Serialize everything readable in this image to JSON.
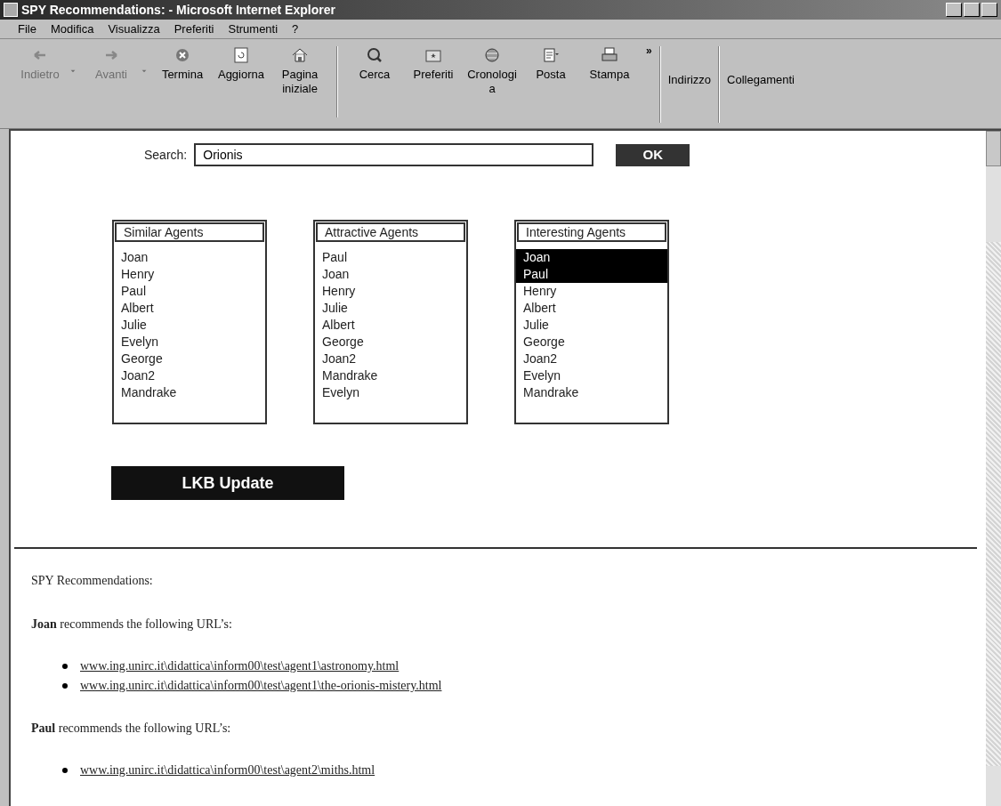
{
  "window": {
    "title": "SPY Recommendations: - Microsoft Internet Explorer"
  },
  "menu": [
    "File",
    "Modifica",
    "Visualizza",
    "Preferiti",
    "Strumenti",
    "?"
  ],
  "toolbar": [
    {
      "kind": "button",
      "label": "Indietro",
      "disabled": true
    },
    {
      "kind": "dropdown",
      "disabled": true
    },
    {
      "kind": "button",
      "label": "Avanti",
      "disabled": true
    },
    {
      "kind": "dropdown",
      "disabled": true
    },
    {
      "kind": "button",
      "label": "Termina",
      "disabled": false
    },
    {
      "kind": "button",
      "label": "Aggiorna",
      "disabled": false
    },
    {
      "kind": "button",
      "label": "Pagina iniziale",
      "disabled": false
    },
    {
      "kind": "separator"
    },
    {
      "kind": "button",
      "label": "Cerca",
      "disabled": false
    },
    {
      "kind": "button",
      "label": "Preferiti",
      "disabled": false
    },
    {
      "kind": "button",
      "label": "Cronologia",
      "disabled": false
    },
    {
      "kind": "button",
      "label": "Posta",
      "disabled": false
    },
    {
      "kind": "button",
      "label": "Stampa",
      "disabled": false
    },
    {
      "kind": "more",
      "label": "»"
    }
  ],
  "address_bar": {
    "label": "Indirizzo"
  },
  "links_bar": {
    "label": "Collegamenti"
  },
  "search": {
    "label": "Search:",
    "value": "Orionis",
    "button": "OK"
  },
  "lists": [
    {
      "title": "Similar Agents",
      "items": [
        {
          "label": "Joan",
          "selected": false
        },
        {
          "label": "Henry",
          "selected": false
        },
        {
          "label": "Paul",
          "selected": false
        },
        {
          "label": "Albert",
          "selected": false
        },
        {
          "label": "Julie",
          "selected": false
        },
        {
          "label": "Evelyn",
          "selected": false
        },
        {
          "label": "George",
          "selected": false
        },
        {
          "label": "Joan2",
          "selected": false
        },
        {
          "label": "Mandrake",
          "selected": false
        }
      ]
    },
    {
      "title": "Attractive Agents",
      "items": [
        {
          "label": "Paul",
          "selected": false
        },
        {
          "label": "Joan",
          "selected": false
        },
        {
          "label": "Henry",
          "selected": false
        },
        {
          "label": "Julie",
          "selected": false
        },
        {
          "label": "Albert",
          "selected": false
        },
        {
          "label": "George",
          "selected": false
        },
        {
          "label": "Joan2",
          "selected": false
        },
        {
          "label": "Mandrake",
          "selected": false
        },
        {
          "label": "Evelyn",
          "selected": false
        }
      ]
    },
    {
      "title": "Interesting Agents",
      "items": [
        {
          "label": "Joan",
          "selected": true
        },
        {
          "label": "Paul",
          "selected": true
        },
        {
          "label": "Henry",
          "selected": false
        },
        {
          "label": "Albert",
          "selected": false
        },
        {
          "label": "Julie",
          "selected": false
        },
        {
          "label": "George",
          "selected": false
        },
        {
          "label": "Joan2",
          "selected": false
        },
        {
          "label": "Evelyn",
          "selected": false
        },
        {
          "label": "Mandrake",
          "selected": false
        }
      ]
    }
  ],
  "update_button": "LKB Update",
  "recommendations": {
    "heading": "SPY Recommendations:",
    "groups": [
      {
        "text": "**Joan** recommends the following URL’s:",
        "links": [
          "www.ing.unirc.it\\didattica\\inform00\\test\\agent1\\astronomy.html",
          "www.ing.unirc.it\\didattica\\inform00\\test\\agent1\\the-orionis-mistery.html"
        ]
      },
      {
        "text": "**Paul** recommends the following URL’s:",
        "links": [
          "www.ing.unirc.it\\didattica\\inform00\\test\\agent2\\miths.html"
        ]
      }
    ]
  }
}
